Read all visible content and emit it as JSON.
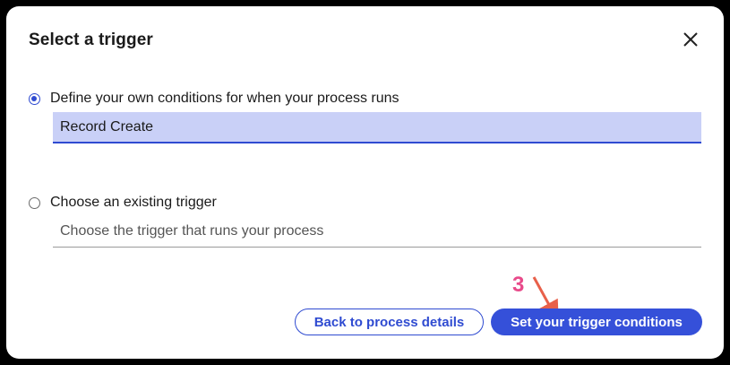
{
  "dialog": {
    "title": "Select a trigger",
    "close_icon": "close-icon"
  },
  "options": [
    {
      "label": "Define your own conditions for when your process runs",
      "checked": true,
      "field_value": "Record Create"
    },
    {
      "label": "Choose an existing trigger",
      "checked": false,
      "field_placeholder": "Choose the trigger that runs your process"
    }
  ],
  "buttons": {
    "back_label": "Back to process details",
    "primary_label": "Set your trigger conditions"
  },
  "annotation": {
    "step_number": "3",
    "color": "#e84a8a"
  },
  "colors": {
    "accent": "#2f4bd1",
    "selected_field_bg": "#c9d0f7"
  }
}
